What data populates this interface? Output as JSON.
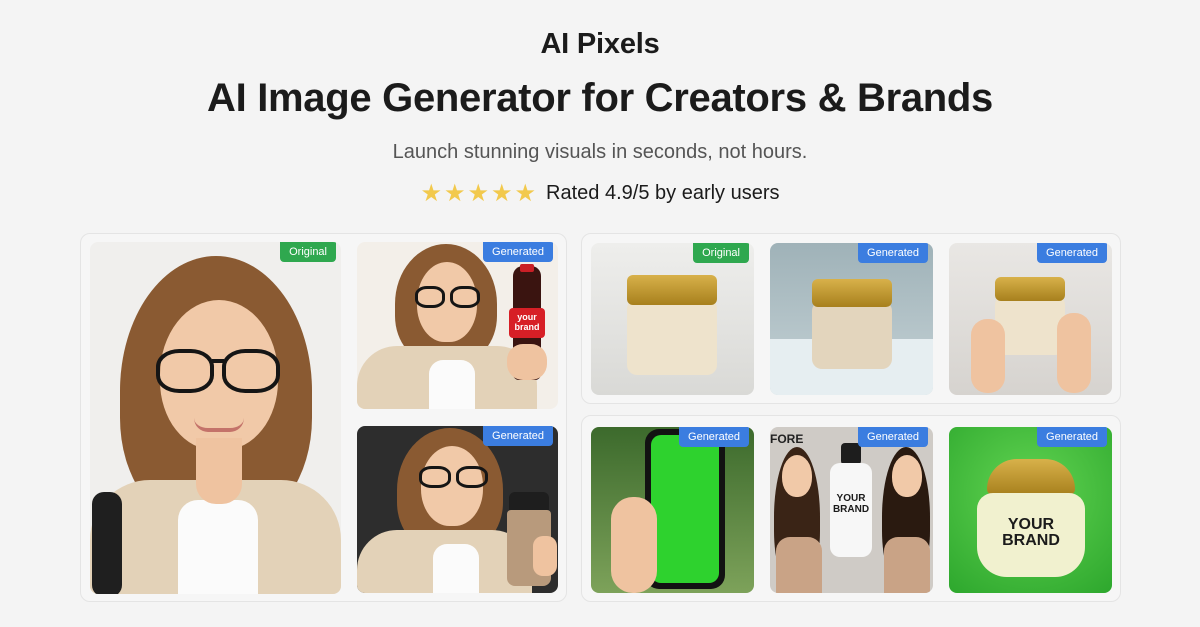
{
  "header": {
    "brand": "AI Pixels",
    "headline": "AI Image Generator for Creators & Brands",
    "subtitle": "Launch stunning visuals in seconds, not hours.",
    "stars": 5,
    "rating_text": "Rated 4.9/5 by early users"
  },
  "badges": {
    "original": "Original",
    "generated": "Generated"
  },
  "images": {
    "bottle_label": "your brand",
    "bottle_label_line1": "your",
    "bottle_label_line2": "brand",
    "jar_label_line1": "YOUR",
    "jar_label_line2": "BRAND",
    "shampoo_label_line1": "YOUR",
    "shampoo_label_line2": "BRAND",
    "poster_text": "FORE"
  },
  "colors": {
    "original_badge": "#2fa84f",
    "generated_badge": "#3b7de0",
    "star": "#f2c94c",
    "green_screen": "#2ed22e"
  }
}
